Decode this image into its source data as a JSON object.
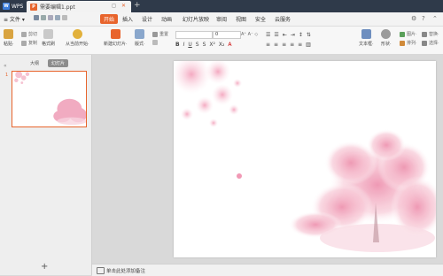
{
  "titlebar": {
    "app_name": "WPS",
    "doc_tab_label": "需要编辑1.ppt",
    "new_tab": "+"
  },
  "menubar": {
    "file_label": "≡ 文件 ▾",
    "start_label": "开始",
    "items": [
      "插入",
      "设计",
      "动画",
      "幻灯片放映",
      "审阅",
      "视图",
      "安全",
      "云服务"
    ]
  },
  "ribbon": {
    "paste": "粘贴·",
    "cut": "剪切",
    "copy": "复制",
    "format_painter": "格式刷",
    "play_from_current": "从当前开始·",
    "new_slide": "新建幻灯片·",
    "layout": "版式·",
    "reset": "重置",
    "font_size_value": "0",
    "text_box": "文本框·",
    "shape": "形状·",
    "picture": "图片·",
    "arrange": "排列·",
    "replace": "替换·",
    "select": "选择·"
  },
  "left_panel": {
    "tab_outline": "大纲",
    "tab_slides": "幻灯片",
    "slide_number": "1",
    "add_slide": "+"
  },
  "notes": {
    "placeholder": "单击此处添加备注"
  },
  "colors": {
    "accent": "#e8642c",
    "titlebar": "#2f3a4a",
    "blossom": "#f2a9c0"
  }
}
